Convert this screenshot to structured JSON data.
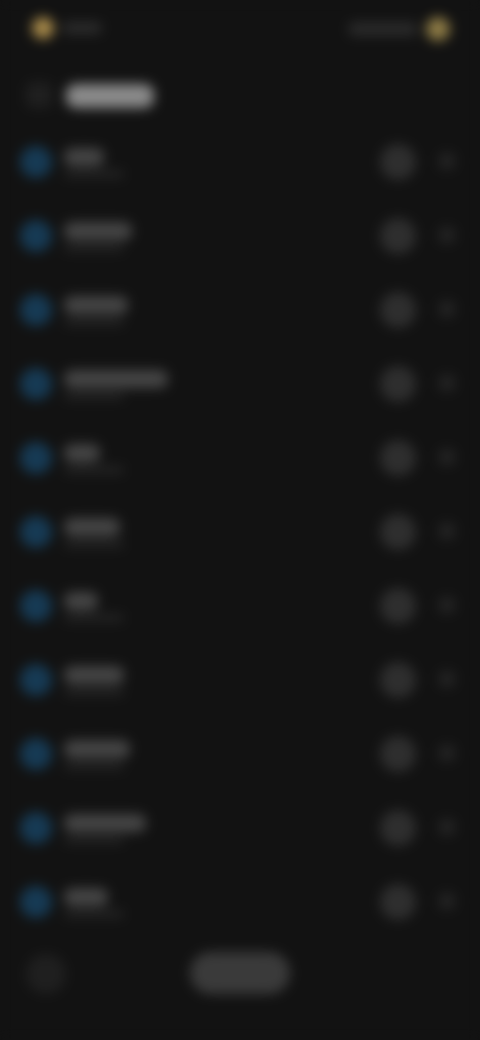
{
  "colors": {
    "background": "#121212",
    "accent_blue": "#163a54",
    "status_gold": "#a88a4a"
  },
  "status_bar": {
    "left_icon": "app-status-icon",
    "right_icon": "status-indicator-icon"
  },
  "header": {
    "back_icon": "back-icon"
  },
  "rows": [
    {
      "icon": "item-icon"
    },
    {
      "icon": "item-icon"
    },
    {
      "icon": "item-icon"
    },
    {
      "icon": "item-icon"
    },
    {
      "icon": "item-icon"
    },
    {
      "icon": "item-icon"
    },
    {
      "icon": "item-icon"
    },
    {
      "icon": "item-icon"
    },
    {
      "icon": "item-icon"
    },
    {
      "icon": "item-icon"
    },
    {
      "icon": "item-icon"
    }
  ],
  "bottom_bar": {
    "left_icon": "menu-icon"
  }
}
